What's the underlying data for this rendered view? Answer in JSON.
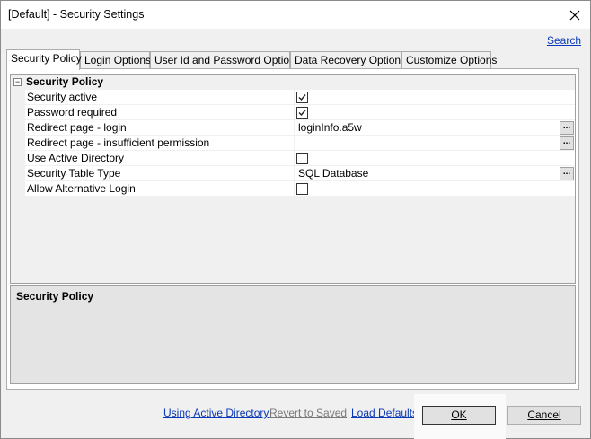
{
  "window": {
    "title": "[Default] - Security Settings",
    "close_glyph": "✕"
  },
  "header": {
    "search_link": "Search"
  },
  "tabs": [
    {
      "label": "Security Policy",
      "active": true
    },
    {
      "label": "Login Options",
      "active": false
    },
    {
      "label": "User Id and Password Options",
      "active": false
    },
    {
      "label": "Data Recovery Options",
      "active": false
    },
    {
      "label": "Customize Options",
      "active": false
    }
  ],
  "grid": {
    "category": {
      "label": "Security Policy",
      "toggle": "−",
      "expanded": true
    },
    "properties": [
      {
        "name": "Security active",
        "type": "checkbox",
        "checked": true
      },
      {
        "name": "Password required",
        "type": "checkbox",
        "checked": true
      },
      {
        "name": "Redirect page - login",
        "type": "text",
        "value": "loginInfo.a5w",
        "has_ellipsis": true
      },
      {
        "name": "Redirect page - insufficient permission",
        "type": "text",
        "value": "",
        "has_ellipsis": true
      },
      {
        "name": "Use Active Directory",
        "type": "checkbox",
        "checked": false
      },
      {
        "name": "Security Table Type",
        "type": "text",
        "value": "SQL Database",
        "has_ellipsis": true
      },
      {
        "name": "Allow Alternative Login",
        "type": "checkbox",
        "checked": false
      }
    ],
    "ellipsis_glyph": "..."
  },
  "description": {
    "title": "Security Policy"
  },
  "footer": {
    "links": {
      "active_directory": "Using Active Directory",
      "revert": "Revert to Saved",
      "load_defaults": "Load Defaults"
    },
    "ok_label": "OK",
    "cancel_label": "Cancel"
  },
  "colors": {
    "link": "#0b39b6",
    "disabled_link": "#7a7a7a",
    "dialog_bg": "#f0f0f0"
  }
}
